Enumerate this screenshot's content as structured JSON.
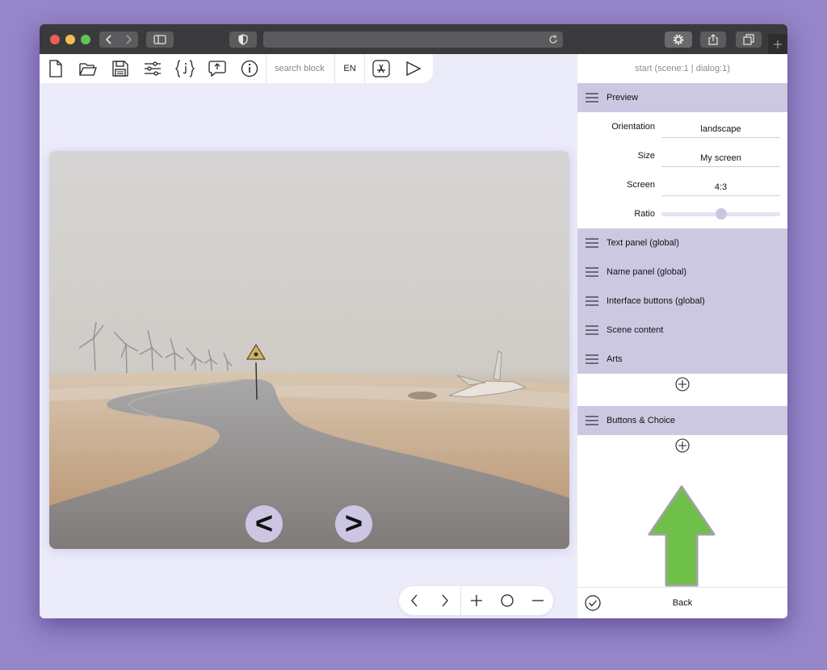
{
  "browser": {
    "back_icon": "chevron-left-icon",
    "forward_icon": "chevron-right-icon",
    "sidebar_icon": "sidebar-icon",
    "shield_icon": "shield-icon",
    "reload_icon": "reload-icon",
    "settings_icon": "gear-icon",
    "share_icon": "share-icon",
    "tabs_icon": "tabs-icon",
    "new_tab_icon": "plus-icon"
  },
  "toolbar": {
    "search_placeholder": "search block",
    "language": "EN",
    "tools": [
      "new-file-icon",
      "open-folder-icon",
      "save-icon",
      "settings-sliders-icon",
      "json-icon",
      "export-icon",
      "info-icon",
      "app-store-icon",
      "play-icon"
    ]
  },
  "preview": {
    "prev_label": "<",
    "next_label": ">",
    "scene_image": "desert-road-wind-turbines-crashed-jet"
  },
  "controls": [
    "chevron-left-icon",
    "chevron-right-icon",
    "zoom-in-icon",
    "reset-zoom-icon",
    "zoom-out-icon"
  ],
  "panel": {
    "header": "start (scene:1 | dialog:1)",
    "preview_section": "Preview",
    "properties": [
      {
        "label": "Orientation",
        "value": "landscape"
      },
      {
        "label": "Size",
        "value": "My screen"
      },
      {
        "label": "Screen",
        "value": "4:3"
      }
    ],
    "ratio_label": "Ratio",
    "ratio_value": 0.5,
    "sections": [
      "Text panel (global)",
      "Name panel (global)",
      "Interface buttons (global)",
      "Scene content",
      "Arts"
    ],
    "buttons_section": "Buttons & Choice",
    "back_label": "Back"
  },
  "colors": {
    "background": "#9585c9",
    "section": "#cdc8e2",
    "arrow": "#6fc048",
    "canvas": "#ecebfa"
  }
}
